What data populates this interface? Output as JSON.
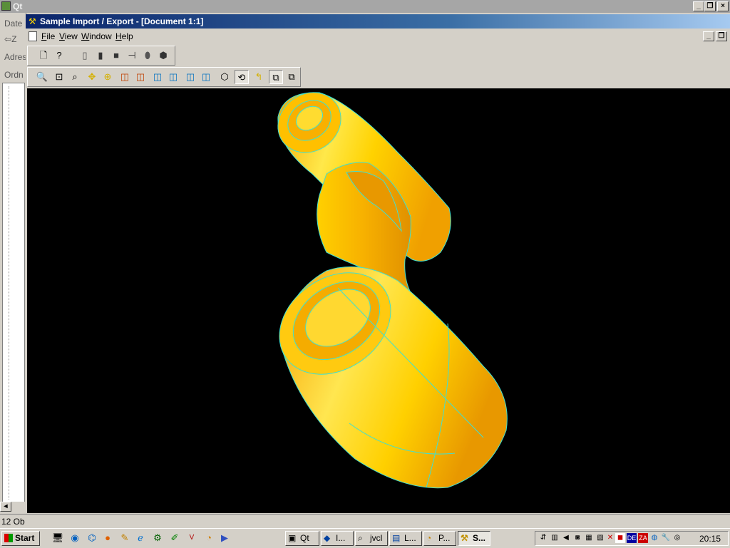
{
  "outer_window": {
    "title": "Qt"
  },
  "explorer": {
    "date_label": "Date",
    "back_label": "Z",
    "address_label": "Adres",
    "folder_label": "Ordn"
  },
  "app": {
    "title": "Sample Import / Export - [Document 1:1]",
    "menu": [
      {
        "label": "File",
        "accel": "F",
        "rest": "ile"
      },
      {
        "label": "View",
        "accel": "V",
        "rest": "iew"
      },
      {
        "label": "Window",
        "accel": "W",
        "rest": "indow"
      },
      {
        "label": "Help",
        "accel": "H",
        "rest": "elp"
      }
    ],
    "toolbar1": [
      "new-document-icon",
      "whats-this-icon",
      "cylinder-wire-icon",
      "cylinder-shaded-icon",
      "square-icon",
      "plug-icon",
      "capsule-icon",
      "hexagon-icon"
    ],
    "toolbar2": [
      "zoom-window-icon",
      "zoom-box-icon",
      "zoom-icon",
      "pan-icon",
      "fit-all-icon",
      "front-view-icon",
      "back-view-icon",
      "top-view-icon",
      "bottom-view-icon",
      "left-view-icon",
      "right-view-icon",
      "axo-view-icon",
      "rotate-icon",
      "reset-view-icon",
      "hidden-lines-on-icon",
      "hidden-lines-off-icon"
    ],
    "viewport_bg": "#000000",
    "model_color": "#ffd700",
    "edge_color": "#40e0d0"
  },
  "status": {
    "text": "12 Ob"
  },
  "taskbar": {
    "start_label": "Start",
    "tasks": [
      {
        "label": "Qt"
      },
      {
        "label": "I..."
      },
      {
        "label": "jvcl"
      },
      {
        "label": "L..."
      },
      {
        "label": "P..."
      },
      {
        "label": "S..."
      }
    ],
    "tray_lang": "DE",
    "clock": "20:15"
  }
}
